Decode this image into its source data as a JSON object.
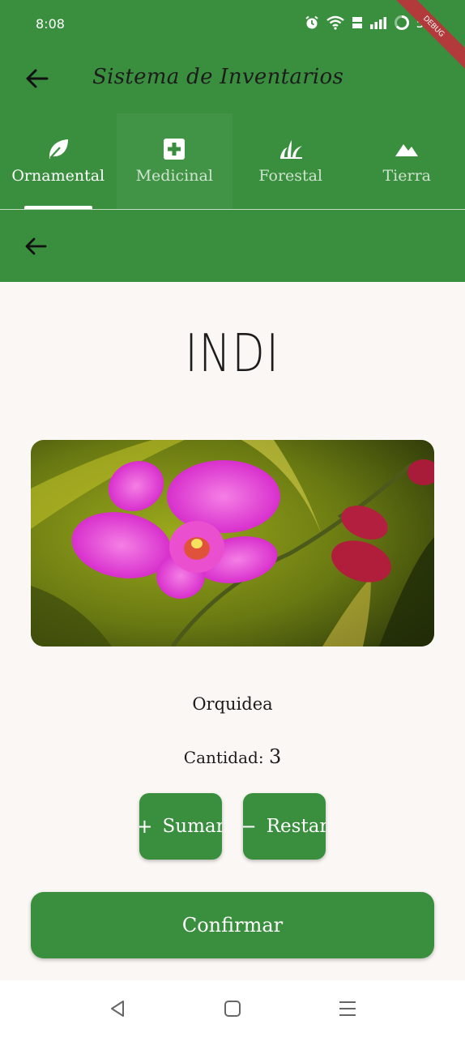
{
  "status_bar": {
    "time": "8:08",
    "battery": "59",
    "debug_banner": "DEBUG"
  },
  "app_bar": {
    "title": "Sistema de Inventarios"
  },
  "tabs": [
    {
      "label": "Ornamental",
      "icon": "leaf-icon",
      "active": true
    },
    {
      "label": "Medicinal",
      "icon": "medical-cross-icon",
      "active": false
    },
    {
      "label": "Forestal",
      "icon": "grass-icon",
      "active": false
    },
    {
      "label": "Tierra",
      "icon": "mountain-icon",
      "active": false
    }
  ],
  "product": {
    "name": "INDI",
    "image": "orchid-photo",
    "type": "Orquidea",
    "quantity_label": "Cantidad:",
    "quantity": "3"
  },
  "actions": {
    "add_label": "Sumar",
    "add_symbol": "+",
    "remove_label": "Restar",
    "remove_symbol": "−",
    "confirm_label": "Confirmar"
  },
  "colors": {
    "primary": "#3a8f3e",
    "background": "#faf7f4",
    "text": "#1c1c1c"
  }
}
